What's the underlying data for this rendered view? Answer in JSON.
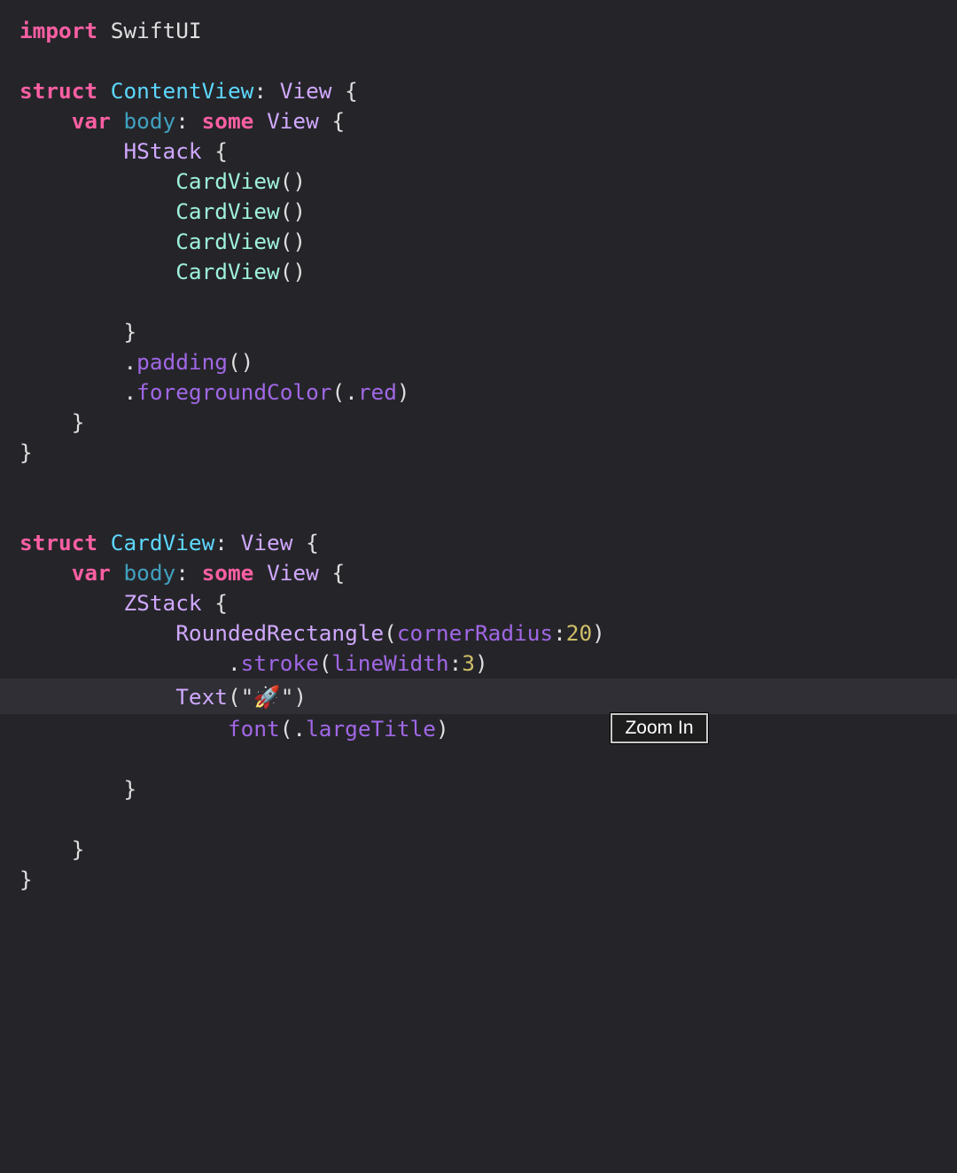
{
  "editor": {
    "current_line": 23,
    "lines": [
      [
        {
          "t": "import",
          "c": "kw"
        },
        {
          "t": " SwiftUI",
          "c": "plain"
        }
      ],
      [],
      [
        {
          "t": "struct",
          "c": "kw"
        },
        {
          "t": " ",
          "c": "plain"
        },
        {
          "t": "ContentView",
          "c": "decl"
        },
        {
          "t": ": ",
          "c": "plain"
        },
        {
          "t": "View",
          "c": "type"
        },
        {
          "t": " {",
          "c": "plain"
        }
      ],
      [
        {
          "t": "    ",
          "c": "plain"
        },
        {
          "t": "var",
          "c": "kw"
        },
        {
          "t": " ",
          "c": "plain"
        },
        {
          "t": "body",
          "c": "prop"
        },
        {
          "t": ": ",
          "c": "plain"
        },
        {
          "t": "some",
          "c": "kw"
        },
        {
          "t": " ",
          "c": "plain"
        },
        {
          "t": "View",
          "c": "type"
        },
        {
          "t": " {",
          "c": "plain"
        }
      ],
      [
        {
          "t": "        ",
          "c": "plain"
        },
        {
          "t": "HStack",
          "c": "type"
        },
        {
          "t": " {",
          "c": "plain"
        }
      ],
      [
        {
          "t": "            ",
          "c": "plain"
        },
        {
          "t": "CardView",
          "c": "proj"
        },
        {
          "t": "()",
          "c": "plain"
        }
      ],
      [
        {
          "t": "            ",
          "c": "plain"
        },
        {
          "t": "CardView",
          "c": "proj"
        },
        {
          "t": "()",
          "c": "plain"
        }
      ],
      [
        {
          "t": "            ",
          "c": "plain"
        },
        {
          "t": "CardView",
          "c": "proj"
        },
        {
          "t": "()",
          "c": "plain"
        }
      ],
      [
        {
          "t": "            ",
          "c": "plain"
        },
        {
          "t": "CardView",
          "c": "proj"
        },
        {
          "t": "()",
          "c": "plain"
        }
      ],
      [],
      [
        {
          "t": "        }",
          "c": "plain"
        }
      ],
      [
        {
          "t": "        .",
          "c": "plain"
        },
        {
          "t": "padding",
          "c": "method"
        },
        {
          "t": "()",
          "c": "plain"
        }
      ],
      [
        {
          "t": "        .",
          "c": "plain"
        },
        {
          "t": "foregroundColor",
          "c": "method"
        },
        {
          "t": "(.",
          "c": "plain"
        },
        {
          "t": "red",
          "c": "method"
        },
        {
          "t": ")",
          "c": "plain"
        }
      ],
      [
        {
          "t": "    }",
          "c": "plain"
        }
      ],
      [
        {
          "t": "}",
          "c": "plain"
        }
      ],
      [],
      [],
      [
        {
          "t": "struct",
          "c": "kw"
        },
        {
          "t": " ",
          "c": "plain"
        },
        {
          "t": "CardView",
          "c": "decl"
        },
        {
          "t": ": ",
          "c": "plain"
        },
        {
          "t": "View",
          "c": "type"
        },
        {
          "t": " {",
          "c": "plain"
        }
      ],
      [
        {
          "t": "    ",
          "c": "plain"
        },
        {
          "t": "var",
          "c": "kw"
        },
        {
          "t": " ",
          "c": "plain"
        },
        {
          "t": "body",
          "c": "prop"
        },
        {
          "t": ": ",
          "c": "plain"
        },
        {
          "t": "some",
          "c": "kw"
        },
        {
          "t": " ",
          "c": "plain"
        },
        {
          "t": "View",
          "c": "type"
        },
        {
          "t": " {",
          "c": "plain"
        }
      ],
      [
        {
          "t": "        ",
          "c": "plain"
        },
        {
          "t": "ZStack",
          "c": "type"
        },
        {
          "t": " {",
          "c": "plain"
        }
      ],
      [
        {
          "t": "            ",
          "c": "plain"
        },
        {
          "t": "RoundedRectangle",
          "c": "type"
        },
        {
          "t": "(",
          "c": "plain"
        },
        {
          "t": "cornerRadius",
          "c": "method"
        },
        {
          "t": ":",
          "c": "plain"
        },
        {
          "t": "20",
          "c": "num"
        },
        {
          "t": ")",
          "c": "plain"
        }
      ],
      [
        {
          "t": "                .",
          "c": "plain"
        },
        {
          "t": "stroke",
          "c": "method"
        },
        {
          "t": "(",
          "c": "plain"
        },
        {
          "t": "lineWidth",
          "c": "method"
        },
        {
          "t": ":",
          "c": "plain"
        },
        {
          "t": "3",
          "c": "num"
        },
        {
          "t": ")",
          "c": "plain"
        }
      ],
      [
        {
          "t": "            ",
          "c": "plain"
        },
        {
          "t": "Text",
          "c": "type"
        },
        {
          "t": "(\"🚀\")",
          "c": "plain"
        }
      ],
      [
        {
          "t": "                ",
          "c": "plain"
        },
        {
          "t": "font",
          "c": "method"
        },
        {
          "t": "(.",
          "c": "plain"
        },
        {
          "t": "largeTitle",
          "c": "method"
        },
        {
          "t": ")",
          "c": "plain"
        }
      ],
      [],
      [
        {
          "t": "        }",
          "c": "plain"
        }
      ],
      [],
      [
        {
          "t": "    }",
          "c": "plain"
        }
      ],
      [
        {
          "t": "}",
          "c": "plain"
        }
      ]
    ]
  },
  "tooltip": {
    "label": "Zoom In"
  },
  "colors": {
    "background": "#252529",
    "keyword": "#fc5fa3",
    "declaration": "#5dd8ff",
    "type": "#d0a8ff",
    "property": "#41a1c0",
    "project": "#9ef1dd",
    "method": "#a167e6",
    "number": "#d0bf69"
  }
}
